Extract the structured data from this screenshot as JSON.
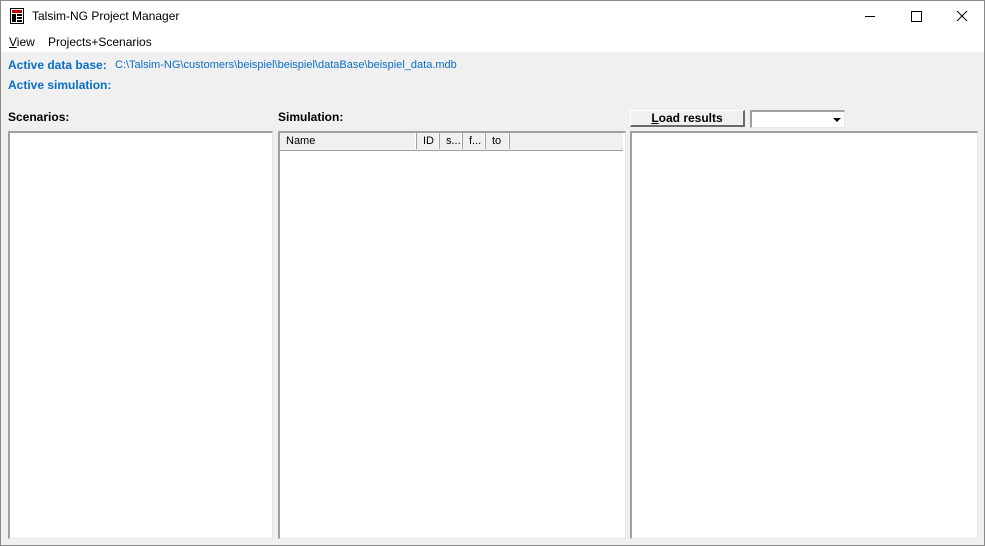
{
  "window": {
    "title": "Talsim-NG Project Manager"
  },
  "menubar": {
    "items": [
      {
        "label": "View",
        "mnemonic": "V",
        "rest": "iew"
      },
      {
        "label": "Projects+Scenarios"
      }
    ]
  },
  "info": {
    "active_db_label": "Active data base:",
    "active_db_value": "C:\\Talsim-NG\\customers\\beispiel\\beispiel\\dataBase\\beispiel_data.mdb",
    "active_sim_label": "Active simulation:",
    "active_sim_value": ""
  },
  "scenarios": {
    "label": "Scenarios:",
    "items": []
  },
  "simulation": {
    "label": "Simulation:",
    "columns": [
      "Name",
      "ID",
      "s...",
      "f...",
      "to"
    ],
    "rows": []
  },
  "results": {
    "load_button_label": "Load results",
    "load_button_mnemonic": "L",
    "load_button_rest": "oad results",
    "dropdown_value": ""
  },
  "colors": {
    "accent": "#0a6ec8",
    "window_bg": "#f0f0f0",
    "panel_bg": "#ffffff"
  }
}
